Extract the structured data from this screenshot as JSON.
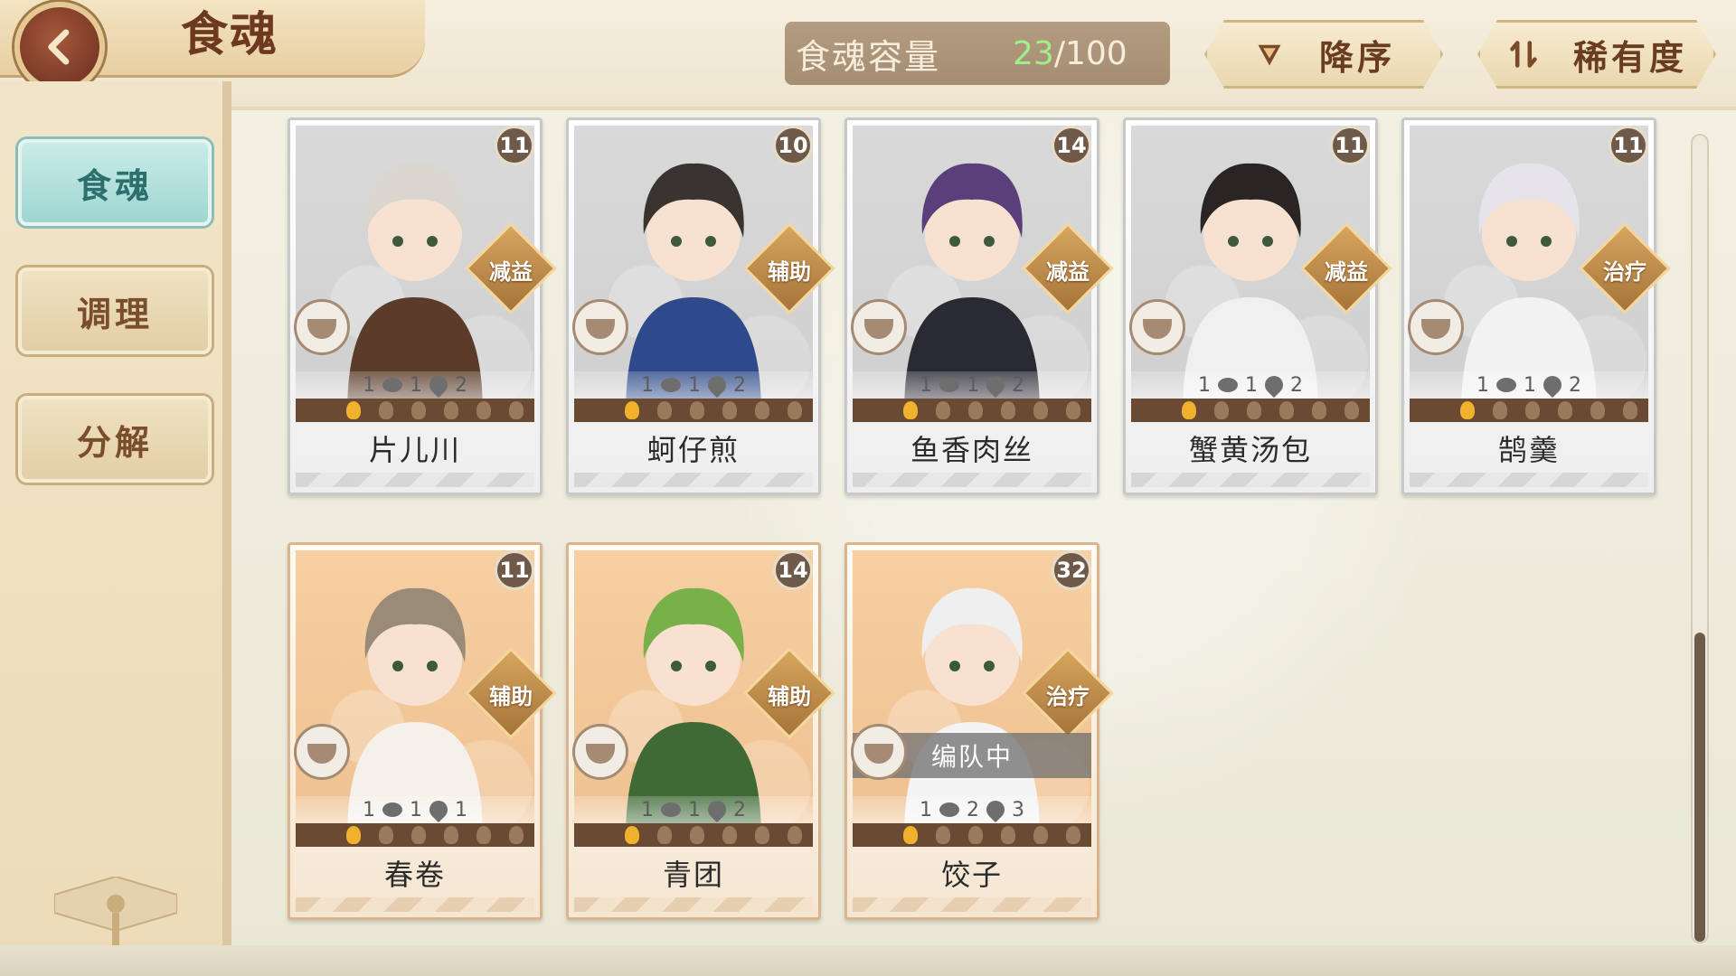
{
  "header": {
    "title": "食魂",
    "capacity_label": "食魂容量",
    "capacity_current": "23",
    "capacity_total": "/100",
    "sort_order_label": "降序",
    "sort_key_label": "稀有度"
  },
  "sidebar": {
    "tabs": [
      {
        "label": "食魂",
        "active": true
      },
      {
        "label": "调理",
        "active": false
      },
      {
        "label": "分解",
        "active": false
      }
    ]
  },
  "cards": [
    {
      "name": "片儿川",
      "level": "11",
      "role": "减益",
      "stat_a": "1",
      "stat_b": "1",
      "stat_c": "2",
      "flames_on": 1,
      "theme": "grey",
      "hair": "#d9d6cf",
      "outfit": "#5b3b2a"
    },
    {
      "name": "蚵仔煎",
      "level": "10",
      "role": "辅助",
      "stat_a": "1",
      "stat_b": "1",
      "stat_c": "2",
      "flames_on": 1,
      "theme": "grey",
      "hair": "#3a3430",
      "outfit": "#2f4a8a"
    },
    {
      "name": "鱼香肉丝",
      "level": "14",
      "role": "减益",
      "stat_a": "1",
      "stat_b": "1",
      "stat_c": "2",
      "flames_on": 1,
      "theme": "grey",
      "hair": "#5b3f7a",
      "outfit": "#2a2a35"
    },
    {
      "name": "蟹黄汤包",
      "level": "11",
      "role": "减益",
      "stat_a": "1",
      "stat_b": "1",
      "stat_c": "2",
      "flames_on": 1,
      "theme": "grey",
      "hair": "#2a2424",
      "outfit": "#f0f0f0"
    },
    {
      "name": "鹄羹",
      "level": "11",
      "role": "治疗",
      "stat_a": "1",
      "stat_b": "1",
      "stat_c": "2",
      "flames_on": 1,
      "theme": "grey",
      "hair": "#e6e4ea",
      "outfit": "#f2f2f2"
    },
    {
      "name": "春卷",
      "level": "11",
      "role": "辅助",
      "stat_a": "1",
      "stat_b": "1",
      "stat_c": "1",
      "flames_on": 1,
      "theme": "orange",
      "hair": "#9a8a78",
      "outfit": "#f5f1ea"
    },
    {
      "name": "青团",
      "level": "14",
      "role": "辅助",
      "stat_a": "1",
      "stat_b": "1",
      "stat_c": "2",
      "flames_on": 1,
      "theme": "orange",
      "hair": "#78b04a",
      "outfit": "#3f6a36"
    },
    {
      "name": "饺子",
      "level": "32",
      "role": "治疗",
      "stat_a": "1",
      "stat_b": "2",
      "stat_c": "3",
      "flames_on": 1,
      "theme": "orange",
      "hair": "#efefef",
      "outfit": "#f4f4f4",
      "status": "编队中"
    }
  ],
  "colors": {
    "accent_teal": "#9fd6d2",
    "capacity_current": "#9ff08a",
    "role_badge": "#c08a48"
  }
}
